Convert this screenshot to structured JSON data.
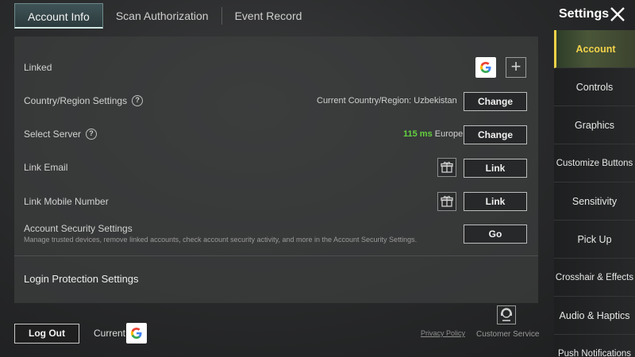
{
  "tabs": [
    {
      "label": "Account Info",
      "active": true
    },
    {
      "label": "Scan Authorization",
      "active": false
    },
    {
      "label": "Event Record",
      "active": false
    }
  ],
  "header": {
    "title": "Settings"
  },
  "account": {
    "linked_label": "Linked",
    "country": {
      "label": "Country/Region Settings",
      "current_text": "Current Country/Region: Uzbekistan",
      "button": "Change"
    },
    "server": {
      "label": "Select Server",
      "ping": "115 ms",
      "region": "Europe",
      "button": "Change"
    },
    "email": {
      "label": "Link Email",
      "button": "Link"
    },
    "mobile": {
      "label": "Link Mobile Number",
      "button": "Link"
    },
    "security": {
      "label": "Account Security Settings",
      "description": "Manage trusted devices, remove linked accounts, check account security activity, and more in the Account Security Settings.",
      "button": "Go"
    },
    "login_protection": {
      "title": "Login Protection Settings"
    }
  },
  "sidebar": {
    "items": [
      {
        "label": "Account",
        "active": true
      },
      {
        "label": "Controls"
      },
      {
        "label": "Graphics"
      },
      {
        "label": "Customize Buttons"
      },
      {
        "label": "Sensitivity"
      },
      {
        "label": "Pick Up"
      },
      {
        "label": "Crosshair & Effects"
      },
      {
        "label": "Audio & Haptics"
      },
      {
        "label": "Push Notifications"
      }
    ]
  },
  "footer": {
    "logout": "Log Out",
    "current": "Current",
    "privacy": "Privacy Policy",
    "customer_service": "Customer Service"
  },
  "colors": {
    "accent_active": "#f1d24a",
    "ping_green": "#63d23f"
  },
  "icons": {
    "google": "google-g-icon",
    "plus": "plus-icon",
    "gift": "gift-icon",
    "close": "close-icon",
    "help": "help-circle-icon",
    "service": "customer-service-icon"
  }
}
